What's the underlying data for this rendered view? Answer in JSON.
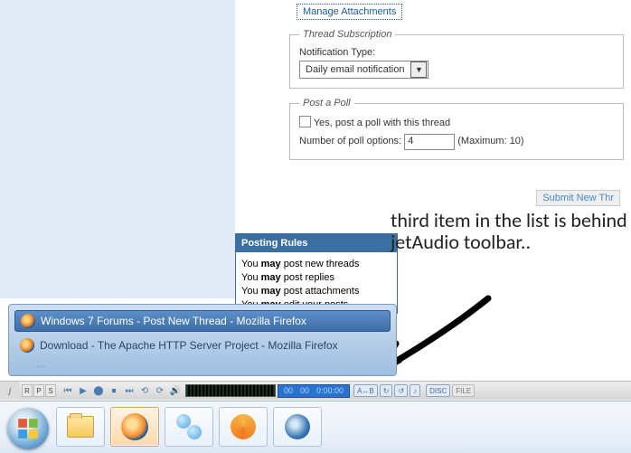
{
  "form": {
    "manage_attachments": "Manage Attachments",
    "subscription": {
      "legend": "Thread Subscription",
      "label": "Notification Type:",
      "value": "Daily email notification"
    },
    "poll": {
      "legend": "Post a Poll",
      "checkbox_label": "Yes, post a poll with this thread",
      "num_label": "Number of poll options:",
      "num_value": "4",
      "max_label": "(Maximum: 10)"
    },
    "submit": "Submit New Thr"
  },
  "rules": {
    "header": "Posting Rules",
    "lines": [
      {
        "pre": "You ",
        "may": "may",
        "post": " post new threads"
      },
      {
        "pre": "You ",
        "may": "may",
        "post": " post replies"
      },
      {
        "pre": "You ",
        "may": "may",
        "post": " post attachments"
      },
      {
        "pre": "You ",
        "may": "may",
        "post": " edit your posts"
      }
    ]
  },
  "annotation": "third item in the list is behind jetAudio toolbar..",
  "preview": {
    "active": "Windows 7 Forums - Post New Thread - Mozilla Firefox",
    "second": "Download - The Apache HTTP Server Project - Mozilla Firefox"
  },
  "jet": {
    "seg": [
      "R",
      "P",
      "S"
    ],
    "time_a": "00",
    "time_b": "00",
    "time_c": "0:00:00",
    "tags": [
      "A↔B",
      "↻",
      "↺",
      "♪"
    ],
    "disc": "DISC",
    "file": "FILE"
  }
}
